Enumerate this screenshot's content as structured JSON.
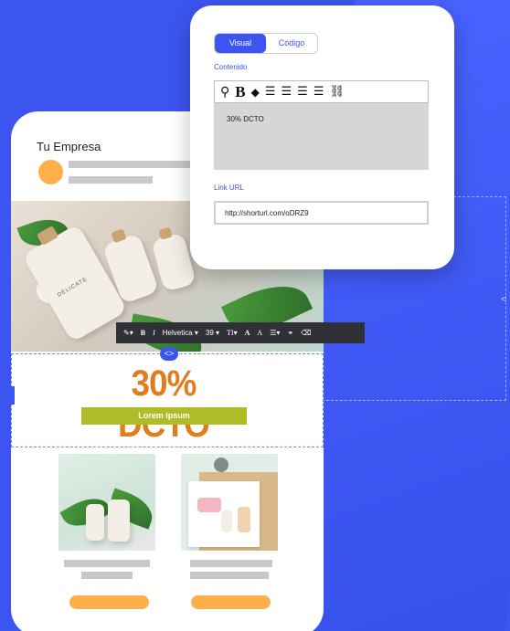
{
  "editor": {
    "tabs": [
      {
        "label": "Visual",
        "active": true
      },
      {
        "label": "Código",
        "active": false
      }
    ],
    "content_label": "Contenido",
    "content_text": "30% DCTO",
    "link_label": "Link URL",
    "link_value": "http://shorturl.com/oDRZ9",
    "toolbar_icons": [
      "paperclip-icon",
      "bold-icon",
      "eraser-icon",
      "align-left-icon",
      "align-center-icon",
      "align-right-icon",
      "align-justify-icon",
      "unlink-icon"
    ]
  },
  "phone": {
    "company": "Tu Empresa",
    "hero_brand": "DELICATE",
    "promo_title": "30% DCTO",
    "cta_label": "Lorem ipsum"
  },
  "text_toolbar": {
    "font": "Helvetica",
    "size": "39",
    "bold": "B",
    "italic": "I",
    "text_size": "TI",
    "color_a": "A",
    "color_b": "A"
  },
  "colors": {
    "background": "#3d55f0",
    "accent": "#3d55f0",
    "promo": "#e07d1f",
    "cta": "#aebc27",
    "buttons": "#fdb04a"
  }
}
